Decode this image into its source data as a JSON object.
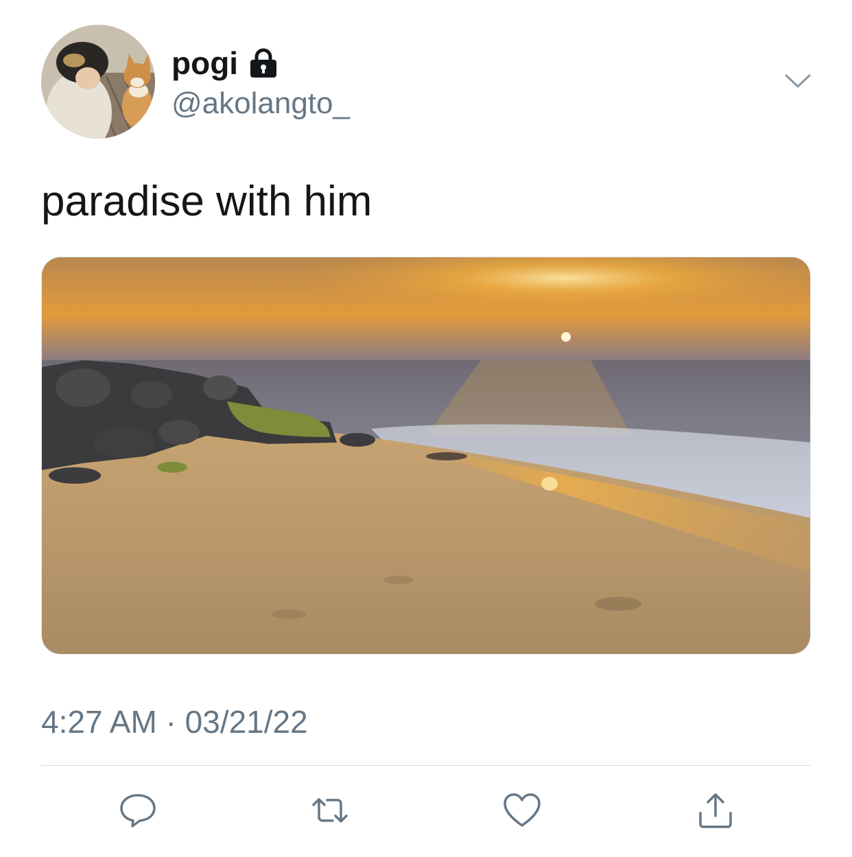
{
  "tweet": {
    "author": {
      "display_name": "pogi",
      "handle": "@akolangto_",
      "protected_icon": "lock-icon"
    },
    "text": "paradise with him",
    "timestamp": "4:27 AM · 03/21/22",
    "menu_icon": "chevron-down-icon"
  },
  "actions": {
    "reply_icon": "reply-icon",
    "retweet_icon": "retweet-icon",
    "like_icon": "heart-icon",
    "share_icon": "share-icon"
  },
  "colors": {
    "text_primary": "#14171a",
    "text_secondary": "#657786",
    "icon_gray": "#657786",
    "divider": "#d6dde3"
  }
}
